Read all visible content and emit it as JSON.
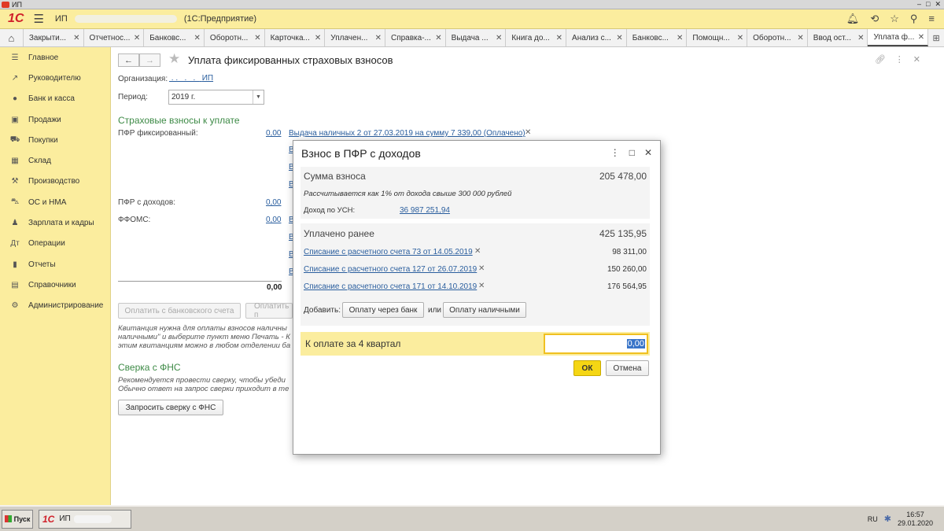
{
  "window": {
    "title": "ИП"
  },
  "app": {
    "logo": "1С",
    "title_prefix": "ИП",
    "title_suffix": "(1С:Предприятие)"
  },
  "tabs": [
    {
      "label": "Закрыти..."
    },
    {
      "label": "Отчетнос..."
    },
    {
      "label": "Банковс..."
    },
    {
      "label": "Оборотн..."
    },
    {
      "label": "Карточка..."
    },
    {
      "label": "Уплачен..."
    },
    {
      "label": "Справка-..."
    },
    {
      "label": "Выдача ..."
    },
    {
      "label": "Книга до..."
    },
    {
      "label": "Анализ с..."
    },
    {
      "label": "Банковс..."
    },
    {
      "label": "Помощн..."
    },
    {
      "label": "Оборотн..."
    },
    {
      "label": "Ввод ост..."
    },
    {
      "label": "Уплата ф..."
    }
  ],
  "sidebar": {
    "items": [
      {
        "label": "Главное",
        "icon": "menu-icon"
      },
      {
        "label": "Руководителю",
        "icon": "trend-icon"
      },
      {
        "label": "Банк и касса",
        "icon": "coins-icon"
      },
      {
        "label": "Продажи",
        "icon": "bag-icon"
      },
      {
        "label": "Покупки",
        "icon": "cart-icon"
      },
      {
        "label": "Склад",
        "icon": "warehouse-icon"
      },
      {
        "label": "Производство",
        "icon": "factory-icon"
      },
      {
        "label": "ОС и НМА",
        "icon": "car-icon"
      },
      {
        "label": "Зарплата и кадры",
        "icon": "person-icon"
      },
      {
        "label": "Операции",
        "icon": "operations-icon"
      },
      {
        "label": "Отчеты",
        "icon": "chart-icon"
      },
      {
        "label": "Справочники",
        "icon": "book-icon"
      },
      {
        "label": "Администрирование",
        "icon": "gear-icon"
      }
    ]
  },
  "form": {
    "title": "Уплата фиксированных страховых взносов",
    "org_label": "Организация:",
    "org_value": "ИП",
    "period_label": "Период:",
    "period_value": "2019 г.",
    "section_insurance": "Страховые взносы к уплате",
    "pfr_fixed_label": "ПФР фиксированный:",
    "pfr_fixed_value": "0,00",
    "pfr_fixed_doc": "Выдача наличных 2 от 27.03.2019 на сумму 7 339,00 (Оплачено)",
    "pfr_income_label": "ПФР с доходов:",
    "pfr_income_value": "0,00",
    "ffoms_label": "ФФОМС:",
    "ffoms_value": "0,00",
    "stub_letter": "В",
    "total_value": "0,00",
    "pay_bank_button": "Оплатить с банковского счета",
    "pay_cash_button": "Оплатить п",
    "note_receipt_1": "Квитанция нужна для оплаты взносов наличны",
    "note_receipt_2": "наличными\" и выберите пункт меню Печать - К",
    "note_receipt_3": "этим квитанциям можно в любом отделении ба",
    "section_fns": "Сверка с ФНС",
    "note_fns_1": "Рекомендуется провести сверку, чтобы убеди",
    "note_fns_2": "Обычно ответ на запрос сверки приходит в те",
    "request_button": "Запросить сверку с ФНС"
  },
  "modal": {
    "title": "Взнос в ПФР с доходов",
    "sum_label": "Сумма взноса",
    "sum_value": "205 478,00",
    "calc_note": "Рассчитывается как 1% от дохода свыше 300 000 рублей",
    "income_label": "Доход по УСН:",
    "income_value": "36 987 251,94",
    "paid_label": "Уплачено ранее",
    "paid_value": "425 135,95",
    "payments": [
      {
        "doc": "Списание с расчетного счета 73 от 14.05.2019",
        "amount": "98 311,00"
      },
      {
        "doc": "Списание с расчетного счета 127 от 26.07.2019",
        "amount": "150 260,00"
      },
      {
        "doc": "Списание с расчетного счета 171 от 14.10.2019",
        "amount": "176 564,95"
      }
    ],
    "add_label": "Добавить:",
    "add_bank_button": "Оплату через банк",
    "or_label": "или",
    "add_cash_button": "Оплату наличными",
    "to_pay_label": "К оплате за 4 квартал",
    "to_pay_value": "0,00",
    "ok_button": "ОК",
    "cancel_button": "Отмена"
  },
  "taskbar": {
    "start": "Пуск",
    "app_label": "ИП",
    "lang": "RU",
    "time": "16:57",
    "date": "29.01.2020"
  },
  "colors": {
    "app_yellow": "#fbed9e",
    "section_green": "#3d8a46",
    "link_blue": "#2a5e9e",
    "ok_yellow": "#f5d614"
  }
}
